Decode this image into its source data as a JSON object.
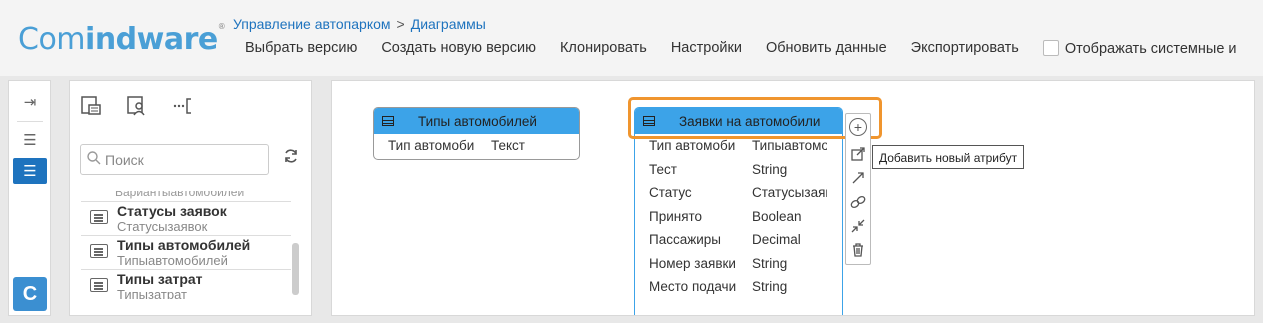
{
  "app": {
    "logo_part1": "Com",
    "logo_part2": "indware",
    "logo_mark": "®"
  },
  "breadcrumb": {
    "item1": "Управление автопарком",
    "separator": ">",
    "item2": "Диаграммы"
  },
  "toolbar": {
    "select_version": "Выбрать версию",
    "create_version": "Создать новую версию",
    "clone": "Клонировать",
    "settings": "Настройки",
    "refresh_data": "Обновить данные",
    "export": "Экспортировать",
    "show_system": "Отображать системные и"
  },
  "sidebar": {
    "search_placeholder": "Поиск",
    "cut_item": "Вариантыавтомобилей",
    "items": [
      {
        "title": "Статусы заявок",
        "subtitle": "Статусызаявок"
      },
      {
        "title": "Типы автомобилей",
        "subtitle": "Типыавтомобилей"
      },
      {
        "title": "Типы затрат",
        "subtitle": "Типызатрат"
      }
    ],
    "logo_letter": "C"
  },
  "diagram": {
    "entity1": {
      "title": "Типы автомобилей",
      "rows": [
        {
          "name": "Тип автомоби",
          "type": "Текст"
        }
      ]
    },
    "entity2": {
      "title": "Заявки на автомобили",
      "rows": [
        {
          "name": "Тип автомоби",
          "type": "Типыавтомо"
        },
        {
          "name": "Тест",
          "type": "String"
        },
        {
          "name": "Статус",
          "type": "Статусызаяв"
        },
        {
          "name": "Принято",
          "type": "Boolean"
        },
        {
          "name": "Пассажиры",
          "type": "Decimal"
        },
        {
          "name": "Номер заявки",
          "type": "String"
        },
        {
          "name": "Место подачи",
          "type": "String"
        }
      ]
    },
    "tooltip": "Добавить новый атрибут"
  },
  "colors": {
    "accent": "#1e73be",
    "entity_header": "#3ca3e8",
    "highlight": "#f0952e"
  }
}
